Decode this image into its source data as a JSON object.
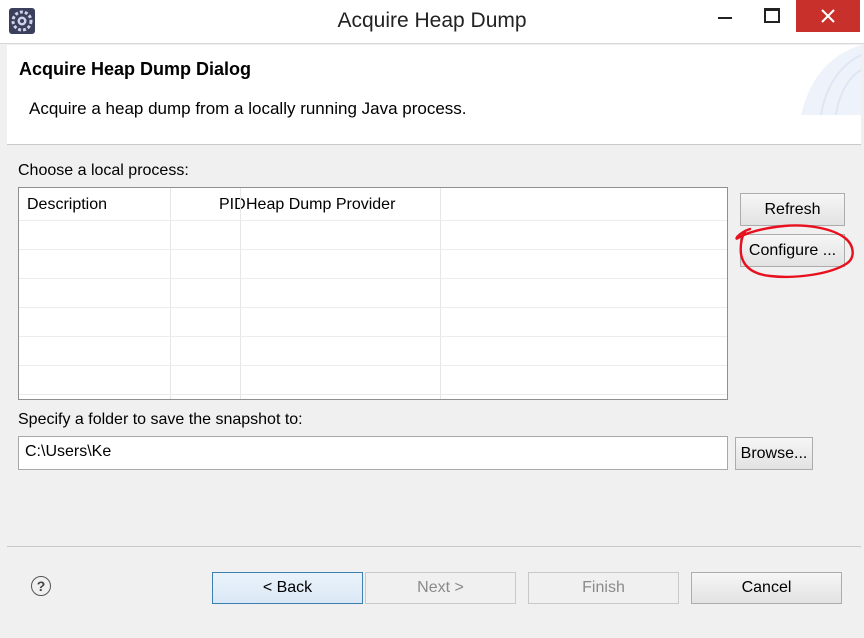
{
  "window": {
    "title": "Acquire Heap Dump"
  },
  "header": {
    "title": "Acquire Heap Dump Dialog",
    "description": "Acquire a heap dump from a locally running Java process."
  },
  "process_section": {
    "label": "Choose a local process:",
    "columns": [
      "Description",
      "PID",
      "Heap Dump Provider"
    ],
    "rows": []
  },
  "side_buttons": {
    "refresh": "Refresh",
    "configure": "Configure ..."
  },
  "folder_section": {
    "label": "Specify a folder to save the snapshot to:",
    "value": "C:\\Users\\Ke",
    "browse": "Browse..."
  },
  "footer": {
    "help_icon": "?",
    "back": "< Back",
    "next": "Next >",
    "finish": "Finish",
    "cancel": "Cancel"
  },
  "colors": {
    "close_button": "#c7302b",
    "annotation": "#e8101e",
    "default_button_border": "#3c7fb1"
  }
}
